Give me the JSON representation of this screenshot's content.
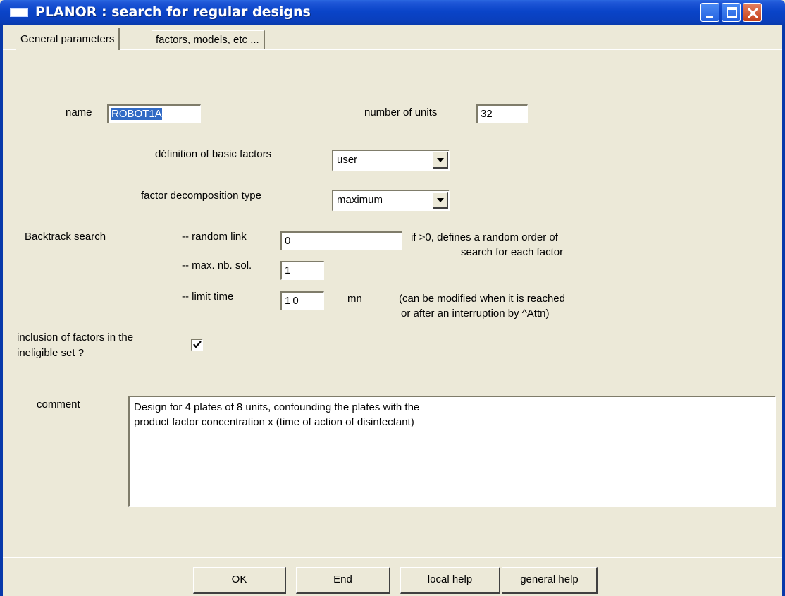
{
  "window": {
    "title": "PLANOR : search for regular designs"
  },
  "tabs": [
    {
      "label": "General parameters",
      "active": true
    },
    {
      "label": "factors, models, etc ...",
      "active": false
    }
  ],
  "form": {
    "name_label": "name",
    "name_value": "ROBOT1A",
    "units_label": "number of units",
    "units_value": "32",
    "basic_factors_label": "définition of basic factors",
    "basic_factors_value": "user",
    "decomposition_label": "factor decomposition type",
    "decomposition_value": "maximum",
    "backtrack_label": "Backtrack search",
    "random_link_label": "-- random link",
    "random_link_value": "0",
    "random_link_note_1": "if >0,  defines a random order of",
    "random_link_note_2": "search for each factor",
    "max_sol_label": "-- max. nb. sol.",
    "max_sol_value": "1",
    "limit_time_label": "-- limit time",
    "limit_time_value": "10",
    "limit_time_unit": "mn",
    "limit_time_note_1": "(can be modified when it is reached",
    "limit_time_note_2": "or after an interruption by ^Attn)",
    "inclusion_label_1": "inclusion of factors in the",
    "inclusion_label_2": "ineligible set ?",
    "inclusion_checked": true,
    "comment_label": "comment",
    "comment_lines": [
      "Design for 4 plates of 8 units, confounding the plates with the",
      "product factor concentration  x (time of action of disinfectant)"
    ]
  },
  "buttons": {
    "ok": "OK",
    "end": "End",
    "local_help": "local help",
    "general_help": "general help"
  },
  "icons": {
    "app": "window-icon",
    "minimize": "minimize-icon",
    "maximize": "maximize-icon",
    "close": "close-icon",
    "dropdown": "chevron-down-icon",
    "check": "checkmark-icon"
  }
}
